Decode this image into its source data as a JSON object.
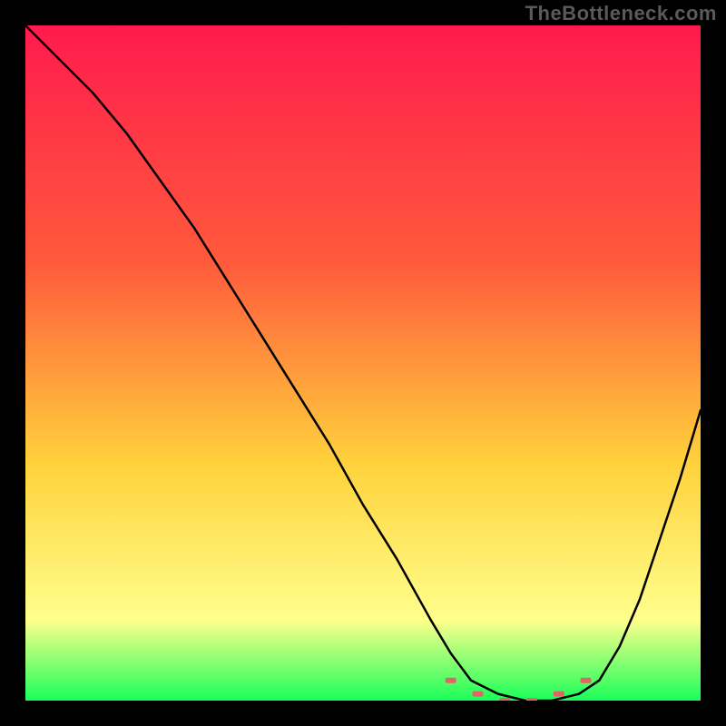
{
  "watermark": "TheBottleneck.com",
  "chart_data": {
    "type": "line",
    "title": "",
    "xlabel": "",
    "ylabel": "",
    "xlim": [
      0,
      100
    ],
    "ylim": [
      0,
      100
    ],
    "grid": false,
    "legend": false,
    "series": [
      {
        "name": "bottleneck-curve",
        "x": [
          0,
          5,
          10,
          15,
          20,
          25,
          30,
          35,
          40,
          45,
          50,
          55,
          60,
          63,
          66,
          70,
          74,
          78,
          82,
          85,
          88,
          91,
          94,
          97,
          100
        ],
        "values": [
          100,
          95,
          90,
          84,
          77,
          70,
          62,
          54,
          46,
          38,
          29,
          21,
          12,
          7,
          3,
          1,
          0,
          0,
          1,
          3,
          8,
          15,
          24,
          33,
          43
        ]
      },
      {
        "name": "optimal-zone",
        "x": [
          63,
          67,
          71,
          75,
          79,
          83
        ],
        "values": [
          3,
          1,
          0,
          0,
          1,
          3
        ]
      }
    ],
    "background_gradient": {
      "top": "#ff1a4d",
      "mid1": "#ff5a3c",
      "mid2": "#ffd23c",
      "low": "#ffff8c",
      "bottom": "#1aff5a"
    },
    "curve_color": "#000000",
    "marker_color": "#e06666"
  }
}
